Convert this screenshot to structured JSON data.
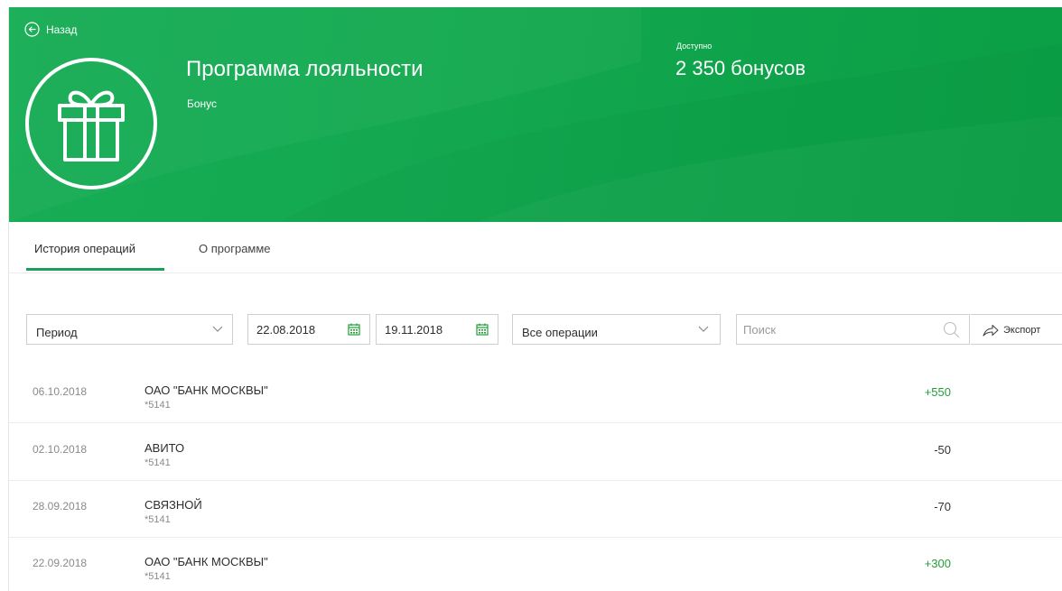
{
  "header": {
    "back_label": "Назад",
    "title": "Программа лояльности",
    "subtitle": "Бонус",
    "available_label": "Доступно",
    "available_value": "2 350 бонусов",
    "logo_icon": "gift-icon",
    "colors": {
      "primary_green": "#13a84f",
      "accent_green": "#21a038"
    }
  },
  "tabs": [
    {
      "label": "История операций",
      "active": true
    },
    {
      "label": "О программе",
      "active": false
    }
  ],
  "filters": {
    "period": "Период",
    "date_from": "22.08.2018",
    "date_to": "19.11.2018",
    "operations": "Все операции",
    "search_placeholder": "Поиск",
    "export_label": "Экспорт",
    "icons": [
      "chevron-down-icon",
      "calendar-icon",
      "search-icon",
      "share-icon"
    ]
  },
  "transactions": [
    {
      "date": "06.10.2018",
      "name": "ОАО \"БАНК МОСКВЫ\"",
      "card": "*5141",
      "amount": "+550",
      "positive": true
    },
    {
      "date": "02.10.2018",
      "name": "АВИТО",
      "card": "*5141",
      "amount": "-50",
      "positive": false
    },
    {
      "date": "28.09.2018",
      "name": "СВЯЗНОЙ",
      "card": "*5141",
      "amount": "-70",
      "positive": false
    },
    {
      "date": "22.09.2018",
      "name": "ОАО \"БАНК МОСКВЫ\"",
      "card": "*5141",
      "amount": "+300",
      "positive": true
    }
  ]
}
